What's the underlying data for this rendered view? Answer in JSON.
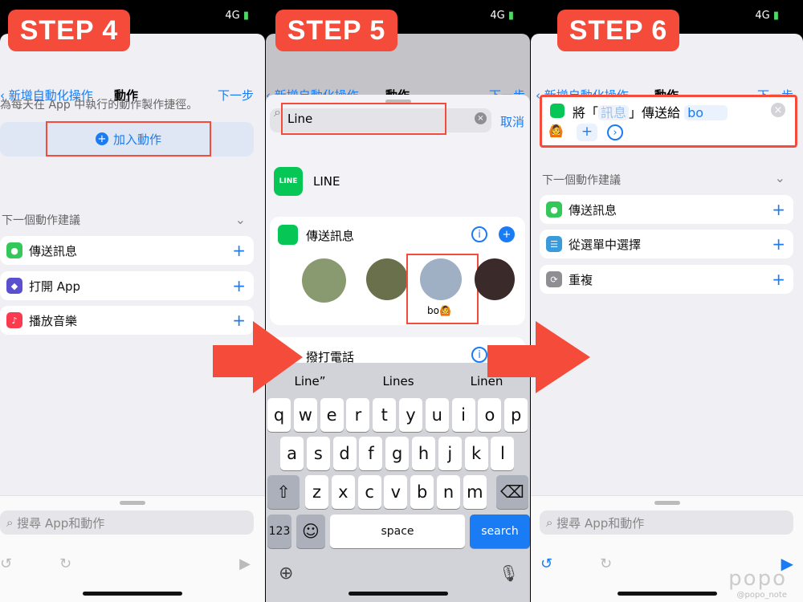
{
  "colors": {
    "accent": "#1a7cf5",
    "step": "#f44b3a",
    "line_green": "#06c755",
    "highlight": "#f44b3a"
  },
  "status": {
    "network": "4G"
  },
  "steps": [
    "STEP 4",
    "STEP 5",
    "STEP 6"
  ],
  "nav": {
    "back": "新增自動化操作",
    "title": "動作",
    "next": "下一步"
  },
  "step4": {
    "description": "為每天在 App 中執行的動作製作捷徑。",
    "add_action": "加入動作",
    "suggest_header": "下一個動作建議",
    "suggestions": [
      {
        "label": "傳送訊息",
        "icon": "messages-icon",
        "color": "#34c759"
      },
      {
        "label": "打開 App",
        "icon": "app-icon",
        "color": "#5a4fcf"
      },
      {
        "label": "播放音樂",
        "icon": "music-icon",
        "color": "#fa3b4f"
      }
    ]
  },
  "step5": {
    "search_value": "Line",
    "cancel": "取消",
    "app_name": "LINE",
    "app_icon_text": "LINE",
    "action1": "傳送訊息",
    "contact_name": "bo",
    "action2": "撥打電話",
    "suggestions": [
      "Line”",
      "Lines",
      "Linen"
    ],
    "keys_row1": [
      "q",
      "w",
      "e",
      "r",
      "t",
      "y",
      "u",
      "i",
      "o",
      "p"
    ],
    "keys_row2": [
      "a",
      "s",
      "d",
      "f",
      "g",
      "h",
      "j",
      "k",
      "l"
    ],
    "keys_row3": [
      "z",
      "x",
      "c",
      "v",
      "b",
      "n",
      "m"
    ],
    "key_123": "123",
    "key_space": "space",
    "key_search": "search"
  },
  "step6": {
    "action_prefix": "將「",
    "action_param": "訊息",
    "action_mid": "」傳送給",
    "recipient": "bo",
    "suggest_header": "下一個動作建議",
    "suggestions": [
      {
        "label": "傳送訊息",
        "icon": "messages-icon",
        "color": "#34c759"
      },
      {
        "label": "從選單中選擇",
        "icon": "menu-icon",
        "color": "#3a9bdc"
      },
      {
        "label": "重複",
        "icon": "repeat-icon",
        "color": "#8e8e93"
      }
    ]
  },
  "bottom": {
    "search_placeholder": "搜尋 App和動作"
  },
  "watermark": {
    "logo": "popo",
    "handle": "@popo_note"
  }
}
